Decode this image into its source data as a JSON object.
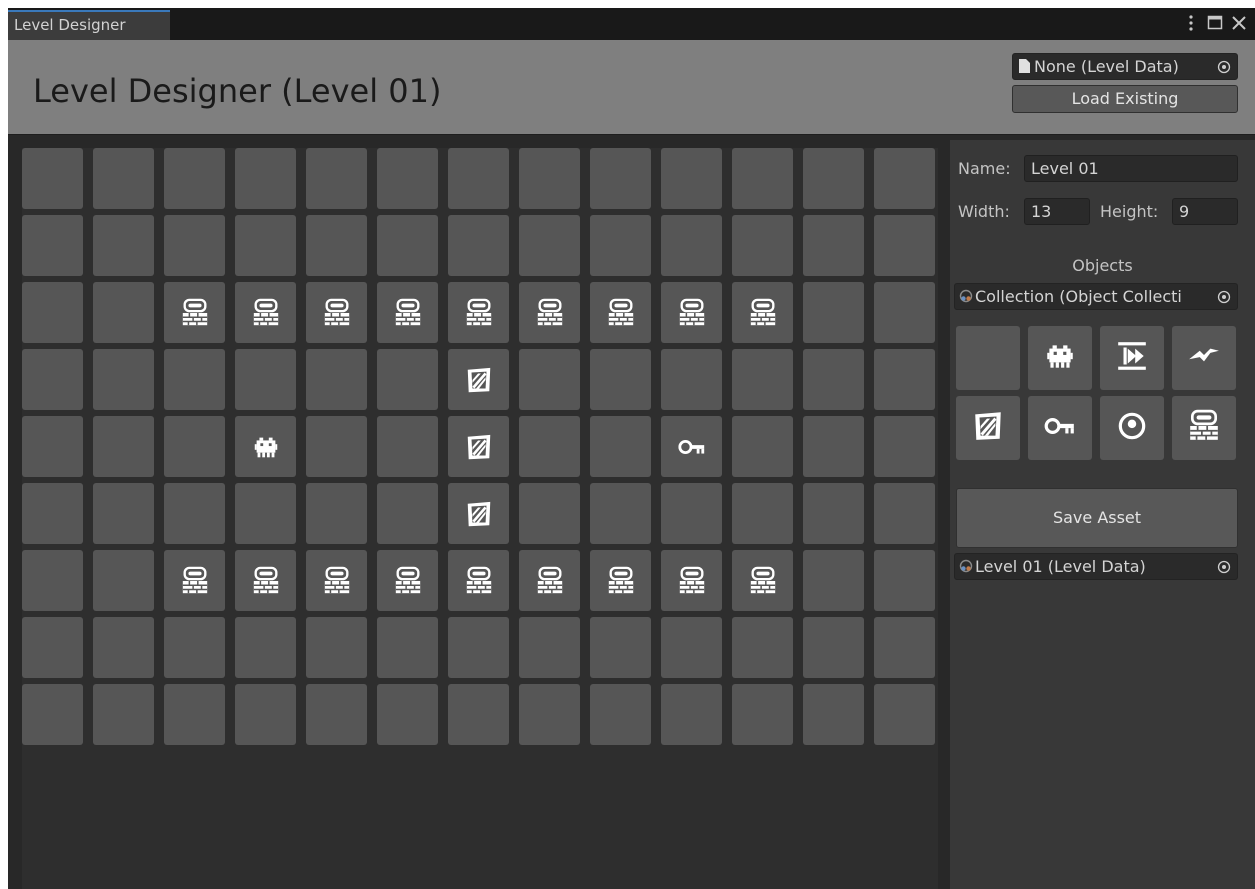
{
  "window": {
    "tab_label": "Level Designer",
    "controls": [
      "more-icon",
      "maximize-icon",
      "close-icon"
    ]
  },
  "header": {
    "title": "Level Designer (Level 01)",
    "level_data_field": "None (Level Data)",
    "load_button": "Load Existing"
  },
  "inspector": {
    "name_label": "Name:",
    "name_value": "Level 01",
    "width_label": "Width:",
    "width_value": "13",
    "height_label": "Height:",
    "height_value": "9",
    "objects_title": "Objects",
    "collection_field": "Collection (Object Collecti",
    "palette": [
      "empty",
      "creature-icon",
      "exit-icon",
      "bolt-icon",
      "crate-icon",
      "key-icon",
      "ring-icon",
      "wall-icon"
    ],
    "save_button": "Save Asset",
    "asset_field": "Level 01 (Level Data)"
  },
  "level": {
    "columns": 13,
    "rows": 9,
    "tiles": [
      [
        0,
        0,
        0,
        0,
        0,
        0,
        0,
        0,
        0,
        0,
        0,
        0,
        0
      ],
      [
        0,
        0,
        0,
        0,
        0,
        0,
        0,
        0,
        0,
        0,
        0,
        0,
        0
      ],
      [
        0,
        0,
        "wall",
        "wall",
        "wall",
        "wall",
        "wall",
        "wall",
        "wall",
        "wall",
        "wall",
        0,
        0
      ],
      [
        0,
        0,
        0,
        0,
        0,
        0,
        "crate",
        0,
        0,
        0,
        0,
        0,
        0
      ],
      [
        0,
        0,
        0,
        "creature",
        0,
        0,
        "crate",
        0,
        0,
        "key",
        0,
        0,
        0
      ],
      [
        0,
        0,
        0,
        0,
        0,
        0,
        "crate",
        0,
        0,
        0,
        0,
        0,
        0
      ],
      [
        0,
        0,
        "wall",
        "wall",
        "wall",
        "wall",
        "wall",
        "wall",
        "wall",
        "wall",
        "wall",
        0,
        0
      ],
      [
        0,
        0,
        0,
        0,
        0,
        0,
        0,
        0,
        0,
        0,
        0,
        0,
        0
      ],
      [
        0,
        0,
        0,
        0,
        0,
        0,
        0,
        0,
        0,
        0,
        0,
        0,
        0
      ]
    ]
  }
}
